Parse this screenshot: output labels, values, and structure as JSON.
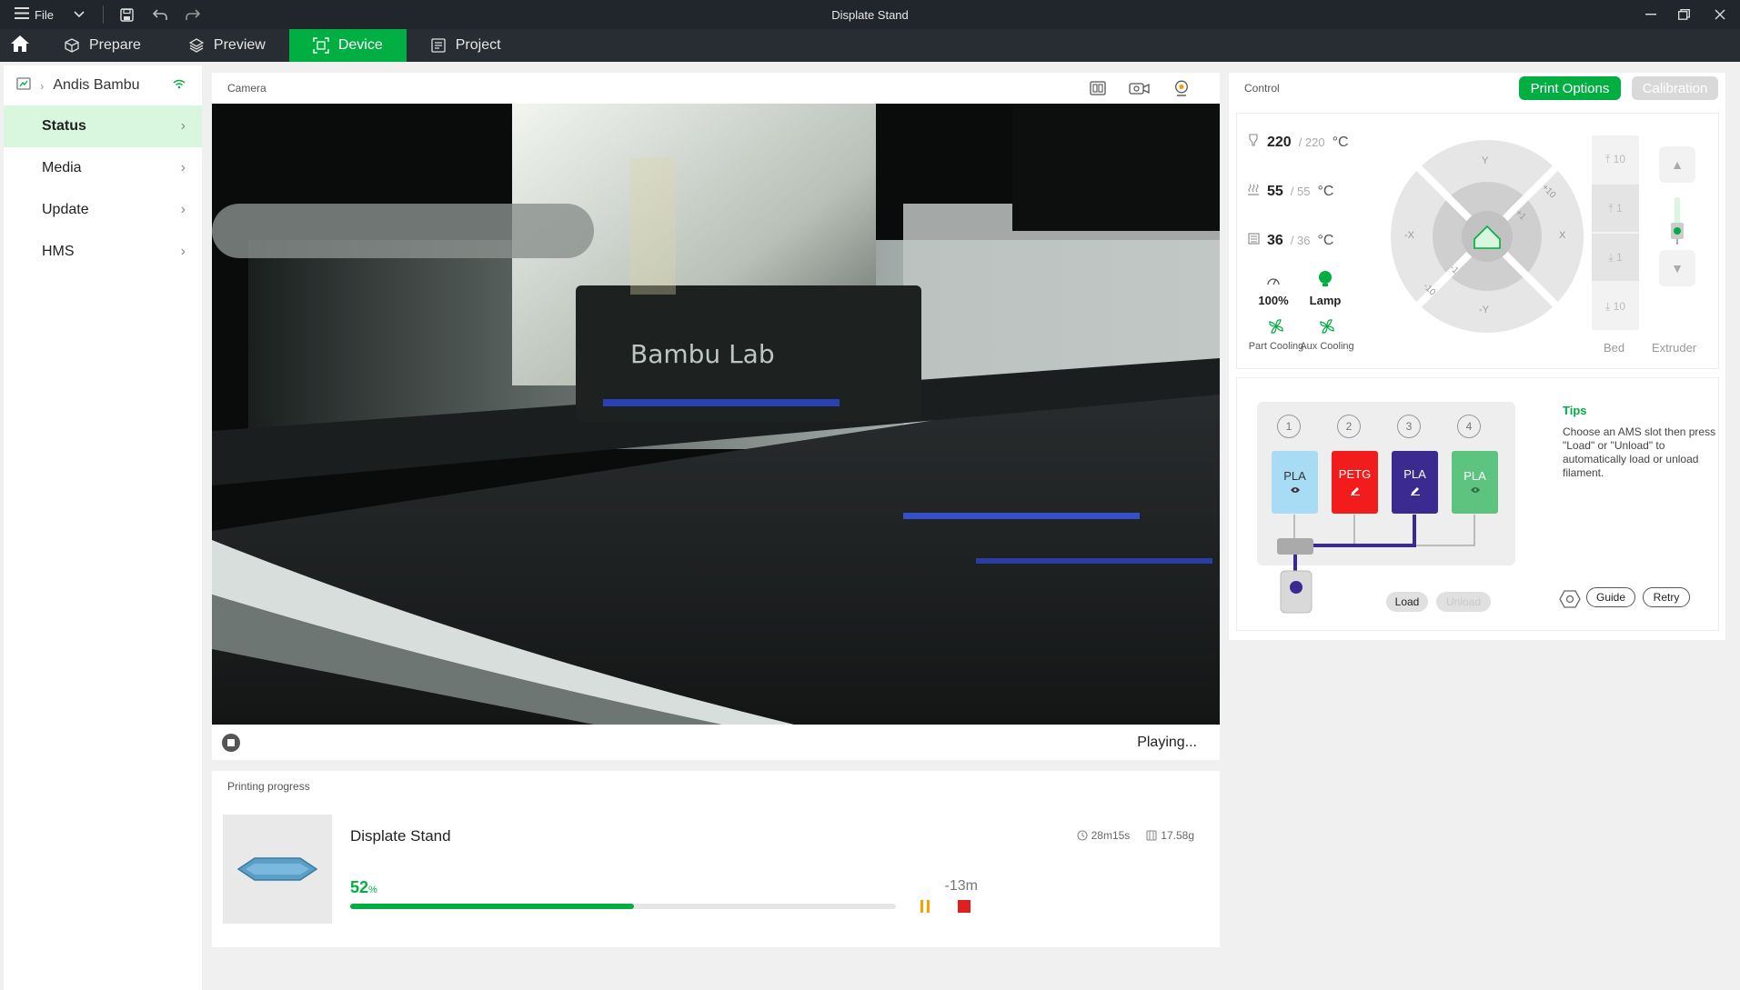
{
  "window": {
    "title": "Displate Stand",
    "file_label": "File"
  },
  "tabs": [
    {
      "label": "Prepare"
    },
    {
      "label": "Preview"
    },
    {
      "label": "Device"
    },
    {
      "label": "Project"
    }
  ],
  "sidebar": {
    "device_name": "Andis Bambu",
    "items": [
      {
        "label": "Status"
      },
      {
        "label": "Media"
      },
      {
        "label": "Update"
      },
      {
        "label": "HMS"
      }
    ]
  },
  "camera": {
    "header": "Camera",
    "status": "Playing..."
  },
  "progress": {
    "header": "Printing progress",
    "job_name": "Displate Stand",
    "time": "28m15s",
    "weight": "17.58g",
    "percent_value": "52",
    "percent_sign": "%",
    "percent_fraction": 0.52,
    "remaining": "-13m"
  },
  "control": {
    "header": "Control",
    "print_options": "Print Options",
    "calibration": "Calibration",
    "nozzle": {
      "current": "220",
      "target": "/ 220",
      "unit": "°C"
    },
    "bed": {
      "current": "55",
      "target": "/ 55",
      "unit": "°C"
    },
    "chamber": {
      "current": "36",
      "target": "/ 36",
      "unit": "°C"
    },
    "speed": "100%",
    "lamp": "Lamp",
    "part_cooling": "Part Cooling",
    "aux_cooling": "Aux Cooling",
    "jog": {
      "y_plus": "Y",
      "y_minus": "-Y",
      "x_plus": "X",
      "x_minus": "-X",
      "plus10": "+10",
      "plus1": "+1",
      "minus1": "-1",
      "minus10": "-10"
    },
    "z_steps": [
      "10",
      "1",
      "1",
      "10"
    ],
    "bed_label": "Bed",
    "extruder_label": "Extruder"
  },
  "ams": {
    "slots": [
      {
        "num": "1",
        "material": "PLA",
        "color": "#a8dcf5",
        "icon": "eye-icon"
      },
      {
        "num": "2",
        "material": "PETG",
        "color": "#f21c1c",
        "icon": "pen-icon"
      },
      {
        "num": "3",
        "material": "PLA",
        "color": "#3b2a8f",
        "icon": "pen-icon"
      },
      {
        "num": "4",
        "material": "PLA",
        "color": "#5cc47f",
        "icon": "eye-icon"
      }
    ],
    "tips_title": "Tips",
    "tips_text": "Choose an AMS slot then press \"Load\" or \"Unload\" to automatically load or unload filament.",
    "load": "Load",
    "unload": "Unload",
    "guide": "Guide",
    "retry": "Retry"
  },
  "colors": {
    "accent": "#00ae42",
    "titlebar": "#20262b",
    "pause": "#ff9d00",
    "stop": "#e02020"
  }
}
